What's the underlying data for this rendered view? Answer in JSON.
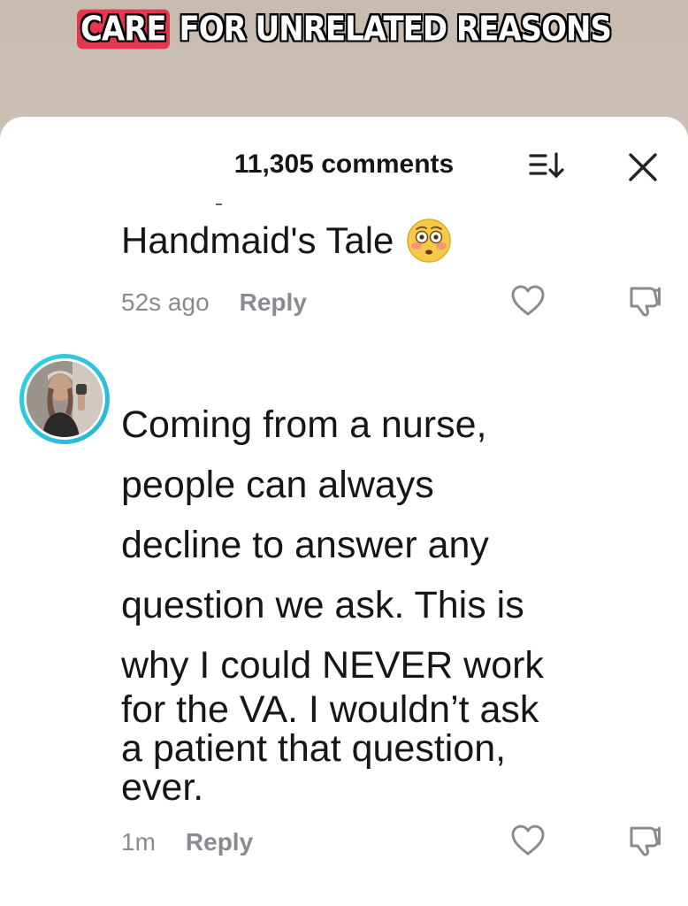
{
  "caption": {
    "highlight": "CARE",
    "rest": "FOR UNRELATED REASONS"
  },
  "header": {
    "comment_count": "11,305 comments"
  },
  "comments": [
    {
      "text": "Handmaid's Tale",
      "emoji": "flushed-face",
      "time": "52s ago",
      "reply_label": "Reply"
    },
    {
      "lines": [
        "Coming from a nurse,",
        "people can always",
        "decline to answer any",
        "question we ask. This is",
        "why I could NEVER work"
      ],
      "tight_lines": [
        "for the VA. I wouldn’t ask",
        "a patient that question,",
        "ever."
      ],
      "time": "1m",
      "reply_label": "Reply"
    }
  ],
  "colors": {
    "caption_highlight": "#e8364e",
    "avatar_ring": "#2fd4e0",
    "meta_text": "#8a8b91"
  },
  "icons": [
    "sort-icon",
    "close-icon",
    "heart-icon",
    "dislike-icon"
  ]
}
